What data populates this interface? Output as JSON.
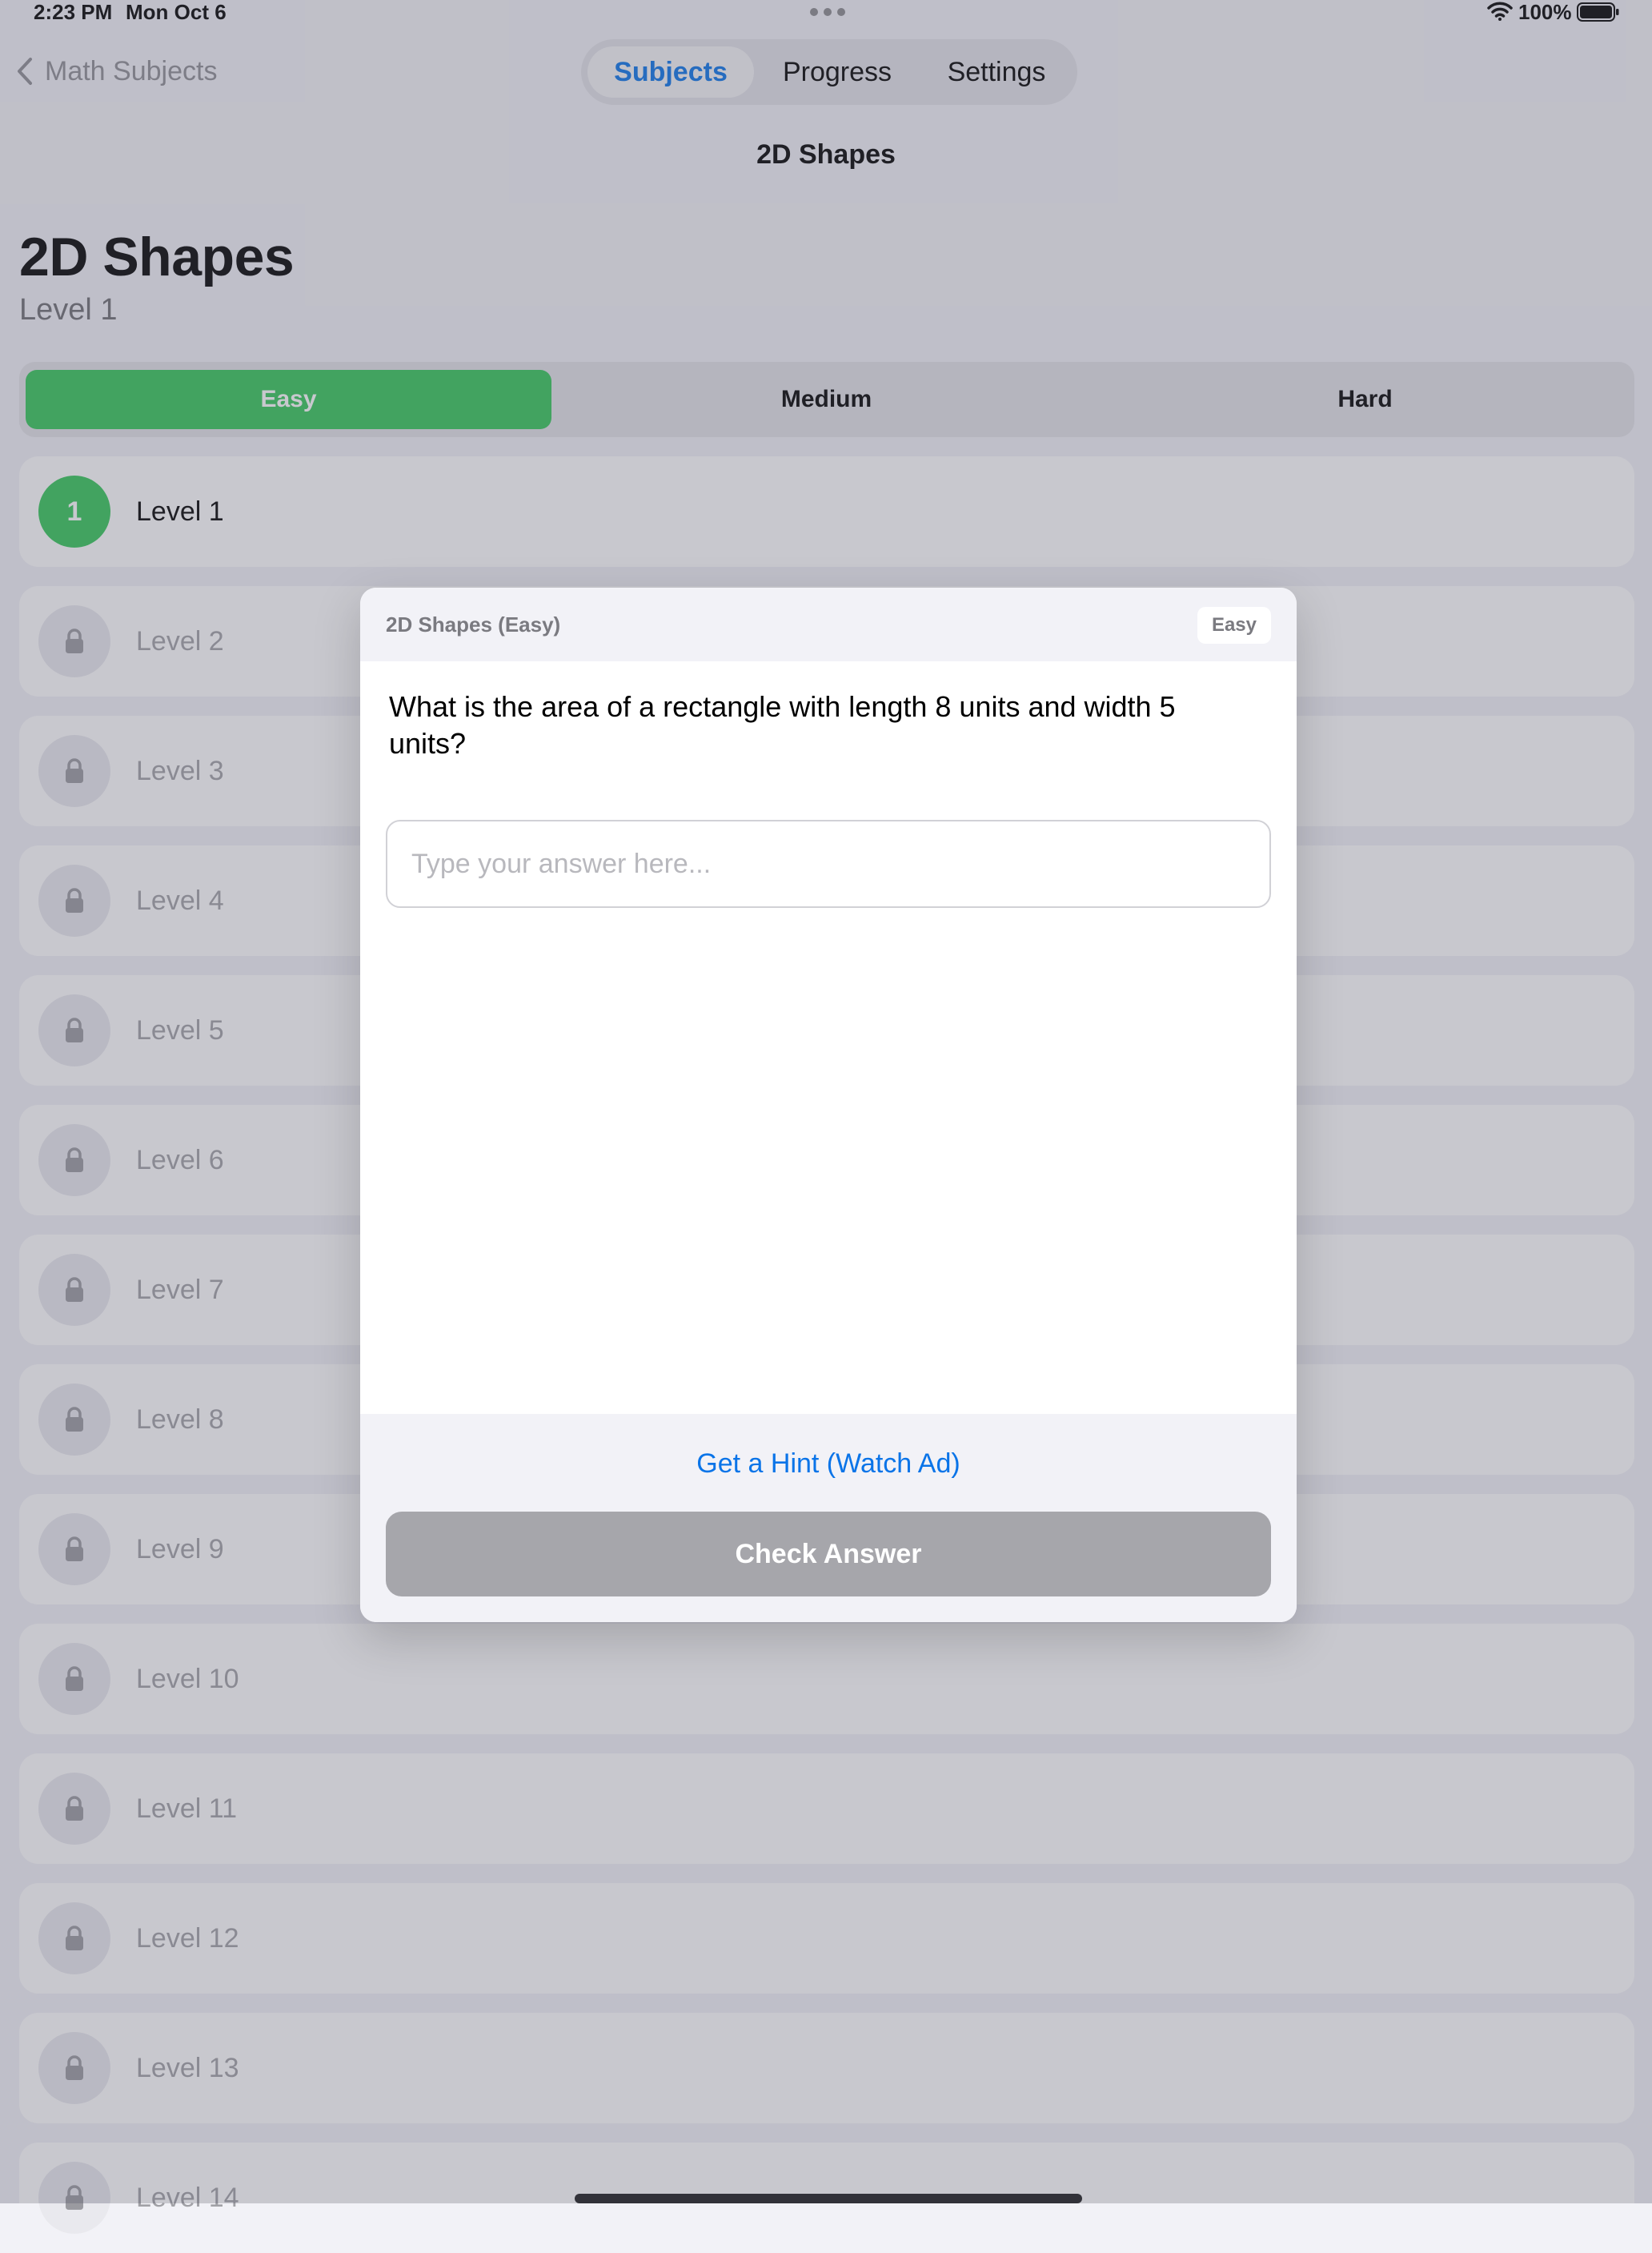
{
  "status_bar": {
    "time": "2:23 PM",
    "date": "Mon Oct 6",
    "battery_percent": "100%"
  },
  "nav": {
    "back_label": "Math Subjects",
    "title": "2D Shapes",
    "tabs": [
      {
        "label": "Subjects",
        "selected": true
      },
      {
        "label": "Progress",
        "selected": false
      },
      {
        "label": "Settings",
        "selected": false
      }
    ]
  },
  "header": {
    "title": "2D Shapes",
    "subtitle": "Level 1"
  },
  "difficulty": {
    "options": [
      "Easy",
      "Medium",
      "Hard"
    ],
    "selected": "Easy"
  },
  "levels": [
    {
      "number": "1",
      "label": "Level 1",
      "locked": false
    },
    {
      "label": "Level 2",
      "locked": true,
      "icon": "lock-icon"
    },
    {
      "label": "Level 3",
      "locked": true,
      "icon": "lock-icon"
    },
    {
      "label": "Level 4",
      "locked": true,
      "icon": "lock-icon"
    },
    {
      "label": "Level 5",
      "locked": true,
      "icon": "lock-icon"
    },
    {
      "label": "Level 6",
      "locked": true,
      "icon": "lock-icon"
    },
    {
      "label": "Level 7",
      "locked": true,
      "icon": "lock-icon"
    },
    {
      "label": "Level 8",
      "locked": true,
      "icon": "lock-icon"
    },
    {
      "label": "Level 9",
      "locked": true,
      "icon": "lock-icon"
    },
    {
      "label": "Level 10",
      "locked": true,
      "icon": "lock-icon"
    },
    {
      "label": "Level 11",
      "locked": true,
      "icon": "lock-icon"
    },
    {
      "label": "Level 12",
      "locked": true,
      "icon": "lock-icon"
    },
    {
      "label": "Level 13",
      "locked": true,
      "icon": "lock-icon"
    },
    {
      "label": "Level 14",
      "locked": true,
      "icon": "lock-icon"
    }
  ],
  "modal": {
    "title": "2D Shapes (Easy)",
    "badge": "Easy",
    "question": "What is the area of a rectangle with length 8 units and width 5 units?",
    "answer_value": "",
    "answer_placeholder": "Type your answer here...",
    "hint_label": "Get a Hint (Watch Ad)",
    "check_label": "Check Answer"
  },
  "colors": {
    "accent": "#0a74e8",
    "success": "#34c759",
    "disabled": "#a6a6ab"
  }
}
